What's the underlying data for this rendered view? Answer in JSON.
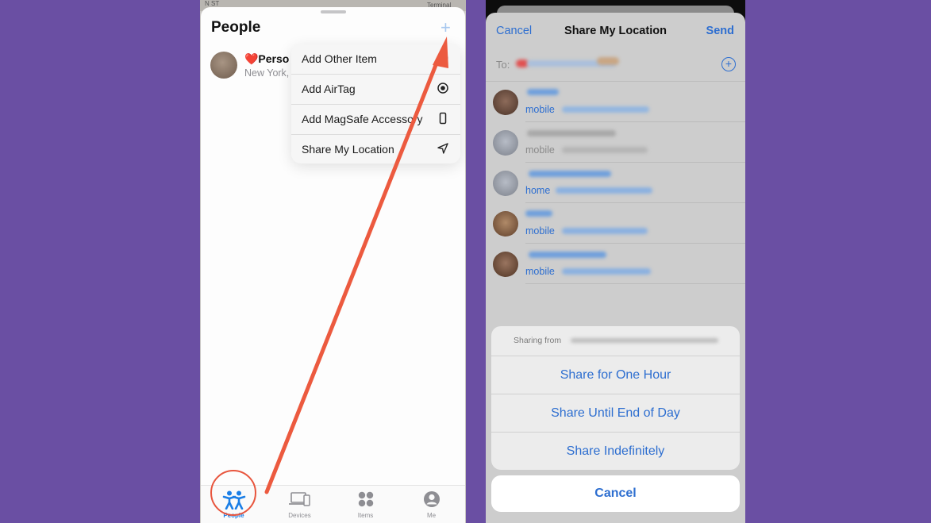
{
  "left_screen": {
    "map_labels": [
      "N ST",
      "Terminal"
    ],
    "title": "People",
    "add_icon": "plus-icon",
    "person": {
      "name": "❤️Perso",
      "location": "New York,"
    },
    "menu": [
      {
        "label": "Add Other Item",
        "icon": "circle-icon"
      },
      {
        "label": "Add AirTag",
        "icon": "airtag-icon"
      },
      {
        "label": "Add MagSafe Accessory",
        "icon": "phone-icon"
      },
      {
        "label": "Share My Location",
        "icon": "location-arrow-icon"
      }
    ],
    "tabs": [
      {
        "label": "People",
        "icon": "people-icon",
        "active": true
      },
      {
        "label": "Devices",
        "icon": "devices-icon",
        "active": false
      },
      {
        "label": "Items",
        "icon": "items-icon",
        "active": false
      },
      {
        "label": "Me",
        "icon": "person-circle-icon",
        "active": false
      }
    ]
  },
  "right_screen": {
    "nav": {
      "cancel": "Cancel",
      "title": "Share My Location",
      "send": "Send"
    },
    "to_label": "To:",
    "contacts": [
      {
        "type": "mobile"
      },
      {
        "type": "mobile"
      },
      {
        "type": "home"
      },
      {
        "type": "mobile"
      },
      {
        "type": "mobile"
      }
    ],
    "sharing_from": "Sharing from",
    "actions": [
      "Share for One Hour",
      "Share Until End of Day",
      "Share Indefinitely"
    ],
    "cancel": "Cancel"
  },
  "colors": {
    "background": "#6a4fa3",
    "accent_blue": "#2d6ed0",
    "annotation_red": "#e8553d"
  }
}
